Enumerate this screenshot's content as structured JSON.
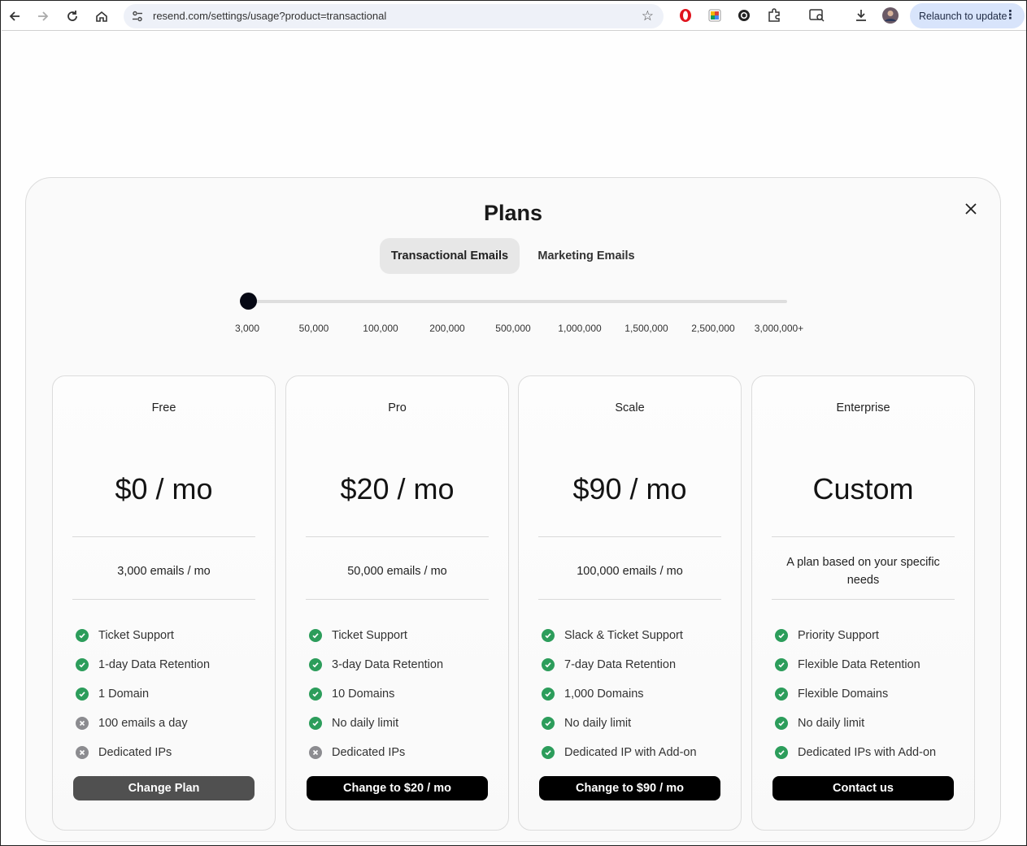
{
  "browser": {
    "url": "resend.com/settings/usage?product=transactional",
    "relaunch_label": "Relaunch to update"
  },
  "modal": {
    "title": "Plans",
    "tabs": [
      {
        "label": "Transactional Emails",
        "active": true
      },
      {
        "label": "Marketing Emails",
        "active": false
      }
    ],
    "slider": {
      "ticks": [
        "3,000",
        "50,000",
        "100,000",
        "200,000",
        "500,000",
        "1,000,000",
        "1,500,000",
        "2,500,000",
        "3,000,000+"
      ],
      "selected": "3,000"
    }
  },
  "plans": [
    {
      "name": "Free",
      "price": "$0 / mo",
      "quota": "3,000 emails / mo",
      "features": [
        {
          "text": "Ticket Support",
          "included": true
        },
        {
          "text": "1-day Data Retention",
          "included": true
        },
        {
          "text": "1 Domain",
          "included": true
        },
        {
          "text": "100 emails a day",
          "included": false
        },
        {
          "text": "Dedicated IPs",
          "included": false
        }
      ],
      "button": "Change Plan"
    },
    {
      "name": "Pro",
      "price": "$20 / mo",
      "quota": "50,000 emails / mo",
      "features": [
        {
          "text": "Ticket Support",
          "included": true
        },
        {
          "text": "3-day Data Retention",
          "included": true
        },
        {
          "text": "10 Domains",
          "included": true
        },
        {
          "text": "No daily limit",
          "included": true
        },
        {
          "text": "Dedicated IPs",
          "included": false
        }
      ],
      "button": "Change to $20 / mo"
    },
    {
      "name": "Scale",
      "price": "$90 / mo",
      "quota": "100,000 emails / mo",
      "features": [
        {
          "text": "Slack & Ticket Support",
          "included": true
        },
        {
          "text": "7-day Data Retention",
          "included": true
        },
        {
          "text": "1,000 Domains",
          "included": true
        },
        {
          "text": "No daily limit",
          "included": true
        },
        {
          "text": "Dedicated IP with Add-on",
          "included": true
        }
      ],
      "button": "Change to $90 / mo"
    },
    {
      "name": "Enterprise",
      "price": "Custom",
      "quota": "A plan based on your specific needs",
      "features": [
        {
          "text": "Priority Support",
          "included": true
        },
        {
          "text": "Flexible Data Retention",
          "included": true
        },
        {
          "text": "Flexible Domains",
          "included": true
        },
        {
          "text": "No daily limit",
          "included": true
        },
        {
          "text": "Dedicated IPs with Add-on",
          "included": true
        }
      ],
      "button": "Contact us"
    }
  ]
}
